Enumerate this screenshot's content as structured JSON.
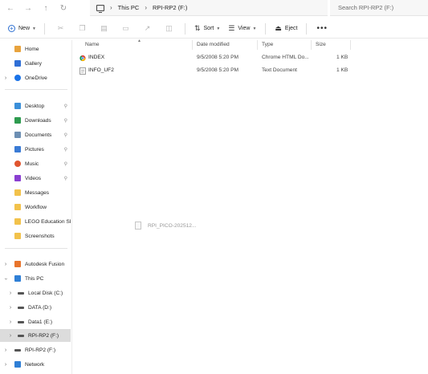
{
  "address_bar": {
    "crumbs": [
      "This PC",
      "RPI-RP2 (F:)"
    ],
    "search_placeholder": "Search RPI-RP2 (F:)"
  },
  "toolbar": {
    "new_label": "New",
    "sort_label": "Sort",
    "view_label": "View",
    "eject_label": "Eject",
    "more_label": "•••"
  },
  "sidebar": {
    "items": [
      {
        "label": "Home",
        "icon": "home-icon",
        "color": "#e8a33d"
      },
      {
        "label": "Gallery",
        "icon": "gallery-icon",
        "color": "#2f6fd6"
      },
      {
        "label": "OneDrive",
        "icon": "onedrive-icon",
        "color": "#1a73e8"
      },
      {
        "label": "Desktop",
        "icon": "desktop-icon",
        "color": "#3b8fd9"
      },
      {
        "label": "Downloads",
        "icon": "download-icon",
        "color": "#2e9b4f"
      },
      {
        "label": "Documents",
        "icon": "documents-icon",
        "color": "#6d8fb3"
      },
      {
        "label": "Pictures",
        "icon": "pictures-icon",
        "color": "#3a7bd5"
      },
      {
        "label": "Music",
        "icon": "music-icon",
        "color": "#e0552f"
      },
      {
        "label": "Videos",
        "icon": "videos-icon",
        "color": "#8a3fd1"
      },
      {
        "label": "Messages",
        "icon": "folder-icon",
        "color": "#f2c24b"
      },
      {
        "label": "Workflow",
        "icon": "folder-icon",
        "color": "#f2c24b"
      },
      {
        "label": "LEGO Education SP",
        "icon": "folder-icon",
        "color": "#f2c24b"
      },
      {
        "label": "Screenshots",
        "icon": "folder-icon",
        "color": "#f2c24b"
      },
      {
        "label": "Autodesk Fusion",
        "icon": "autodesk-icon",
        "color": "#e8742c"
      },
      {
        "label": "This PC",
        "icon": "this-pc-icon",
        "color": "#2f7fd6"
      },
      {
        "label": "Local Disk (C:)",
        "icon": "drive-icon",
        "color": "#555555"
      },
      {
        "label": "DATA (D:)",
        "icon": "drive-icon",
        "color": "#555555"
      },
      {
        "label": "Data1 (E:)",
        "icon": "drive-icon",
        "color": "#555555"
      },
      {
        "label": "RPI-RP2 (F:)",
        "icon": "drive-icon",
        "color": "#555555"
      },
      {
        "label": "RPI-RP2 (F:)",
        "icon": "drive-icon",
        "color": "#555555"
      },
      {
        "label": "Network",
        "icon": "network-icon",
        "color": "#2f7fd6"
      }
    ]
  },
  "columns": {
    "name": "Name",
    "date": "Date modified",
    "type": "Type",
    "size": "Size"
  },
  "files": [
    {
      "name": "INDEX",
      "date": "9/5/2008 5:20 PM",
      "type": "Chrome HTML Do...",
      "size": "1 KB",
      "icon": "chrome-html-icon"
    },
    {
      "name": "INFO_UF2",
      "date": "9/5/2008 5:20 PM",
      "type": "Text Document",
      "size": "1 KB",
      "icon": "text-document-icon"
    }
  ],
  "drag_ghost": {
    "label": "RPI_PICO-202512..."
  },
  "colors": {
    "accent": "#2d6fd1",
    "selected_bg": "#dcdcdc"
  }
}
